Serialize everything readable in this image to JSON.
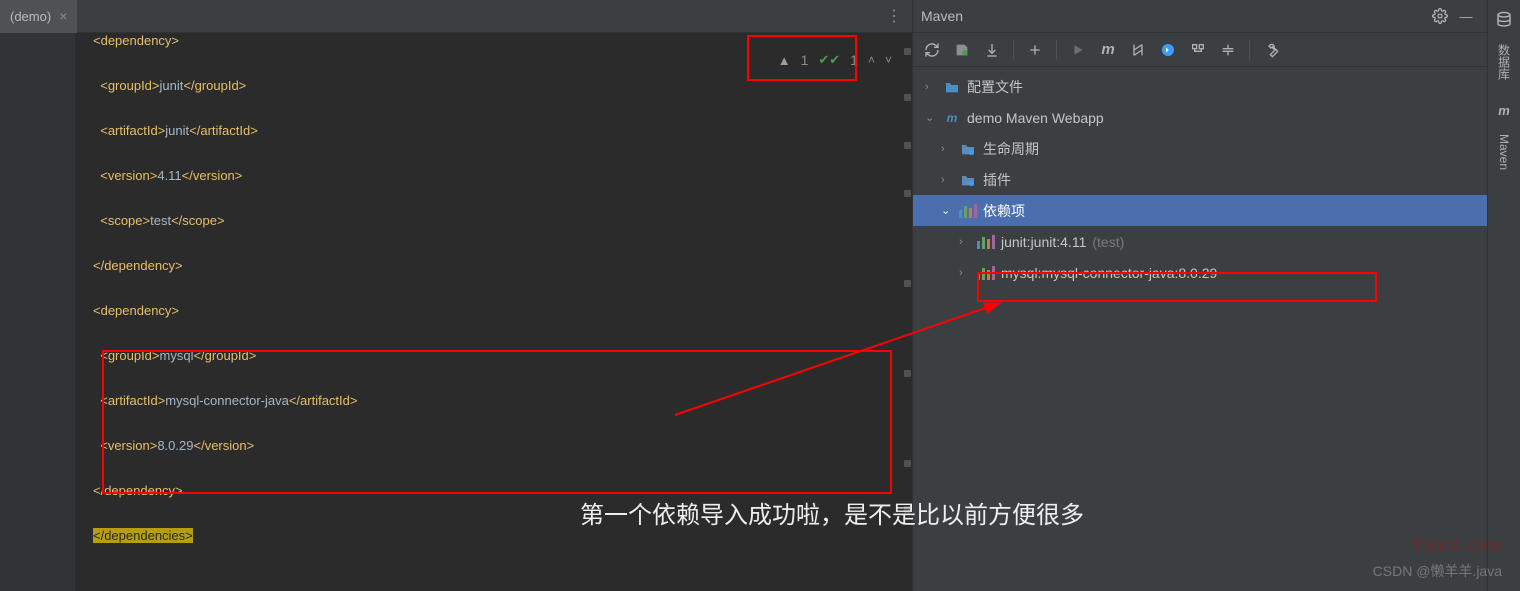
{
  "editor": {
    "tab_label": "(demo)",
    "lines": {
      "l1_open": "<dependency>",
      "l2_g_open": "<groupId>",
      "l2_val": "junit",
      "l2_g_close": "</groupId>",
      "l3_a_open": "<artifactId>",
      "l3_val": "junit",
      "l3_a_close": "</artifactId>",
      "l4_v_open": "<version>",
      "l4_val": "4.11",
      "l4_v_close": "</version>",
      "l5_s_open": "<scope>",
      "l5_val": "test",
      "l5_s_close": "</scope>",
      "l6_close": "</dependency>",
      "l7_open": "<dependency>",
      "l8_g_open": "<groupId>",
      "l8_val": "mysql",
      "l8_g_close": "</groupId>",
      "l9_a_open": "<artifactId>",
      "l9_val": "mysql-connector-java",
      "l9_a_close": "</artifactId>",
      "l10_v_open": "<version>",
      "l10_val": "8.0.29",
      "l10_v_close": "</version>",
      "l11_close": "</dependency>",
      "l12_close": "</dependencies>"
    },
    "inspection": {
      "warnings": "1",
      "oks": "1"
    }
  },
  "maven": {
    "title": "Maven",
    "tree": {
      "profiles": "配置文件",
      "project": "demo Maven Webapp",
      "lifecycle": "生命周期",
      "plugins": "插件",
      "dependencies": "依赖项",
      "dep1": "junit:junit:4.11",
      "dep1_scope": "(test)",
      "dep2": "mysql:mysql-connector-java:8.0.29"
    }
  },
  "siderail": {
    "db": "数据库",
    "mvn": "Maven"
  },
  "annotation": {
    "comment": "第一个依赖导入成功啦，是不是比以前方便很多"
  },
  "watermark": {
    "site": "Yuucn.com",
    "author": "CSDN @懒羊羊.java"
  }
}
